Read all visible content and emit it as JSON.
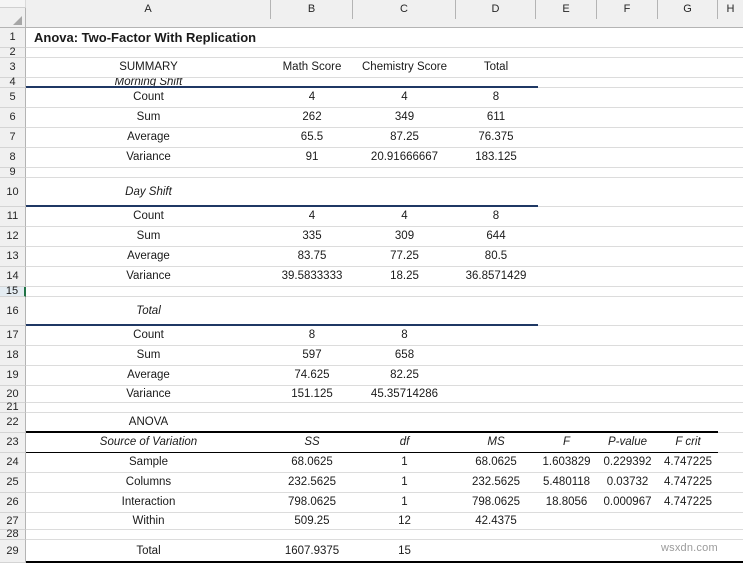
{
  "sheet": {
    "title": "Anova: Two-Factor With Replication",
    "watermark": "wsxdn.com",
    "selected_row": "15"
  },
  "column_headers": [
    "A",
    "B",
    "C",
    "D",
    "E",
    "F",
    "G",
    "H"
  ],
  "row_headers": [
    "1",
    "2",
    "3",
    "4",
    "5",
    "6",
    "7",
    "8",
    "9",
    "10",
    "11",
    "12",
    "13",
    "14",
    "15",
    "16",
    "17",
    "18",
    "19",
    "20",
    "21",
    "22",
    "23",
    "24",
    "25",
    "26",
    "27",
    "28",
    "29"
  ],
  "colors": {
    "section_rule": "#1f3864",
    "anova_rule": "#000000",
    "header_bg": "#f0f0f0",
    "selection_green": "#217346"
  },
  "summary": {
    "label": "SUMMARY",
    "columns": [
      "Math Score",
      "Chemistry Score",
      "Total"
    ],
    "groups": [
      {
        "name": "Morning Shift",
        "rows": [
          {
            "label": "Count",
            "b": "4",
            "c": "4",
            "d": "8"
          },
          {
            "label": "Sum",
            "b": "262",
            "c": "349",
            "d": "611"
          },
          {
            "label": "Average",
            "b": "65.5",
            "c": "87.25",
            "d": "76.375"
          },
          {
            "label": "Variance",
            "b": "91",
            "c": "20.91666667",
            "d": "183.125"
          }
        ]
      },
      {
        "name": "Day Shift",
        "rows": [
          {
            "label": "Count",
            "b": "4",
            "c": "4",
            "d": "8"
          },
          {
            "label": "Sum",
            "b": "335",
            "c": "309",
            "d": "644"
          },
          {
            "label": "Average",
            "b": "83.75",
            "c": "77.25",
            "d": "80.5"
          },
          {
            "label": "Variance",
            "b": "39.5833333",
            "c": "18.25",
            "d": "36.8571429"
          }
        ]
      },
      {
        "name": "Total",
        "rows": [
          {
            "label": "Count",
            "b": "8",
            "c": "8",
            "d": ""
          },
          {
            "label": "Sum",
            "b": "597",
            "c": "658",
            "d": ""
          },
          {
            "label": "Average",
            "b": "74.625",
            "c": "82.25",
            "d": ""
          },
          {
            "label": "Variance",
            "b": "151.125",
            "c": "45.35714286",
            "d": ""
          }
        ]
      }
    ]
  },
  "anova": {
    "label": "ANOVA",
    "headers": [
      "Source of Variation",
      "SS",
      "df",
      "MS",
      "F",
      "P-value",
      "F crit"
    ],
    "rows": [
      {
        "source": "Sample",
        "ss": "68.0625",
        "df": "1",
        "ms": "68.0625",
        "f": "1.603829",
        "p": "0.229392",
        "fcrit": "4.747225"
      },
      {
        "source": "Columns",
        "ss": "232.5625",
        "df": "1",
        "ms": "232.5625",
        "f": "5.480118",
        "p": "0.03732",
        "fcrit": "4.747225"
      },
      {
        "source": "Interaction",
        "ss": "798.0625",
        "df": "1",
        "ms": "798.0625",
        "f": "18.8056",
        "p": "0.000967",
        "fcrit": "4.747225"
      },
      {
        "source": "Within",
        "ss": "509.25",
        "df": "12",
        "ms": "42.4375",
        "f": "",
        "p": "",
        "fcrit": ""
      },
      {
        "source": "",
        "ss": "",
        "df": "",
        "ms": "",
        "f": "",
        "p": "",
        "fcrit": ""
      },
      {
        "source": "Total",
        "ss": "1607.9375",
        "df": "15",
        "ms": "",
        "f": "",
        "p": "",
        "fcrit": ""
      }
    ]
  },
  "chart_data": {
    "type": "table",
    "title": "Anova: Two-Factor With Replication",
    "sections": [
      {
        "name": "SUMMARY",
        "columns": [
          "",
          "Math Score",
          "Chemistry Score",
          "Total"
        ],
        "subtables": [
          {
            "name": "Morning Shift",
            "rows": [
              [
                "Count",
                4,
                4,
                8
              ],
              [
                "Sum",
                262,
                349,
                611
              ],
              [
                "Average",
                65.5,
                87.25,
                76.375
              ],
              [
                "Variance",
                91,
                20.91666667,
                183.125
              ]
            ]
          },
          {
            "name": "Day Shift",
            "rows": [
              [
                "Count",
                4,
                4,
                8
              ],
              [
                "Sum",
                335,
                309,
                644
              ],
              [
                "Average",
                83.75,
                77.25,
                80.5
              ],
              [
                "Variance",
                39.5833333,
                18.25,
                36.8571429
              ]
            ]
          },
          {
            "name": "Total",
            "rows": [
              [
                "Count",
                8,
                8,
                null
              ],
              [
                "Sum",
                597,
                658,
                null
              ],
              [
                "Average",
                74.625,
                82.25,
                null
              ],
              [
                "Variance",
                151.125,
                45.35714286,
                null
              ]
            ]
          }
        ]
      },
      {
        "name": "ANOVA",
        "columns": [
          "Source of Variation",
          "SS",
          "df",
          "MS",
          "F",
          "P-value",
          "F crit"
        ],
        "rows": [
          [
            "Sample",
            68.0625,
            1,
            68.0625,
            1.603829,
            0.229392,
            4.747225
          ],
          [
            "Columns",
            232.5625,
            1,
            232.5625,
            5.480118,
            0.03732,
            4.747225
          ],
          [
            "Interaction",
            798.0625,
            1,
            798.0625,
            18.8056,
            0.000967,
            4.747225
          ],
          [
            "Within",
            509.25,
            12,
            42.4375,
            null,
            null,
            null
          ],
          [
            "Total",
            1607.9375,
            15,
            null,
            null,
            null,
            null
          ]
        ]
      }
    ]
  }
}
